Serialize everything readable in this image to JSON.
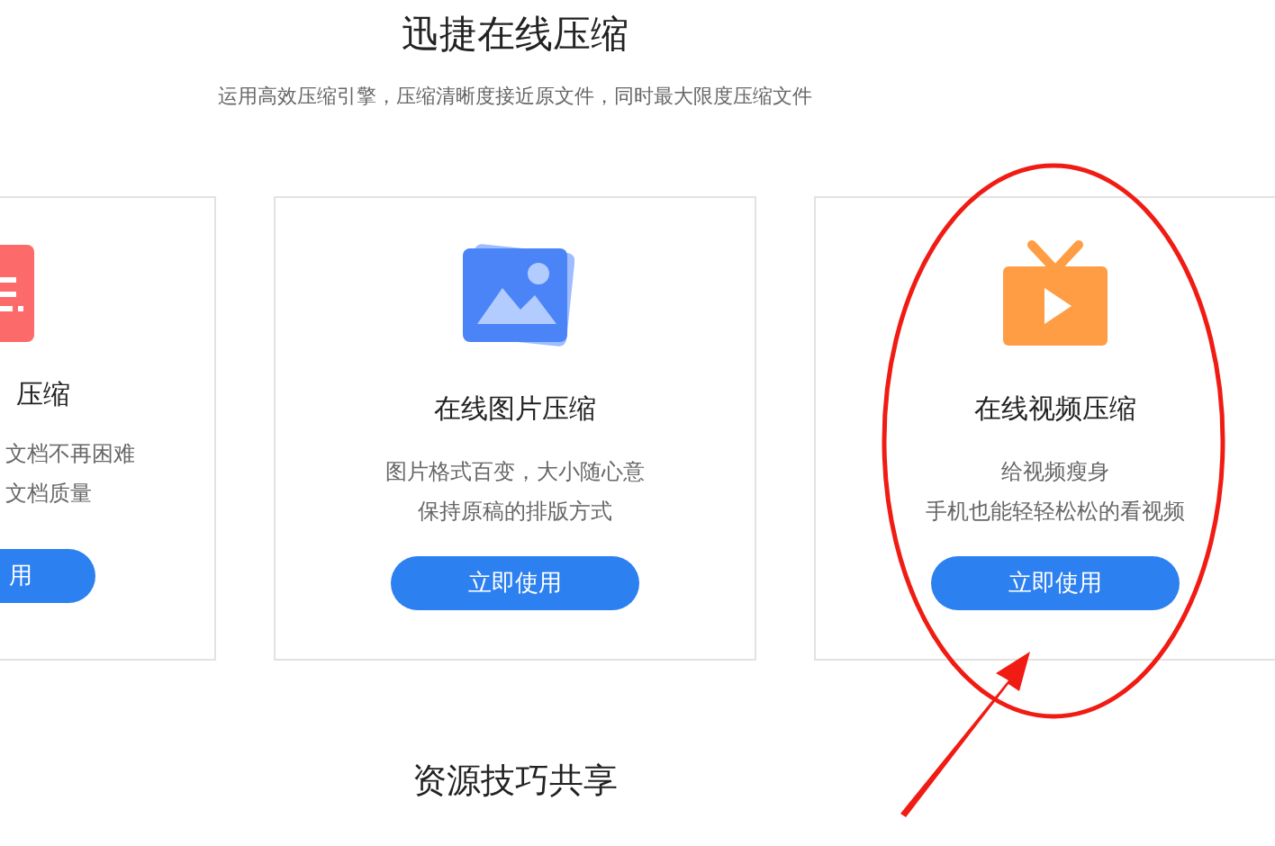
{
  "header": {
    "title": "迅捷在线压缩",
    "subtitle": "运用高效压缩引擎，压缩清晰度接近原文件，同时最大限度压缩文件"
  },
  "cards": [
    {
      "kind": "document",
      "title": "压缩",
      "lines": [
        "文档不再困难",
        "文档质量"
      ],
      "button": "用"
    },
    {
      "kind": "image",
      "title": "在线图片压缩",
      "lines": [
        "图片格式百变，大小随心意",
        "保持原稿的排版方式"
      ],
      "button": "立即使用"
    },
    {
      "kind": "video",
      "title": "在线视频压缩",
      "lines": [
        "给视频瘦身",
        "手机也能轻轻松松的看视频"
      ],
      "button": "立即使用"
    }
  ],
  "next_section": {
    "title": "资源技巧共享"
  }
}
